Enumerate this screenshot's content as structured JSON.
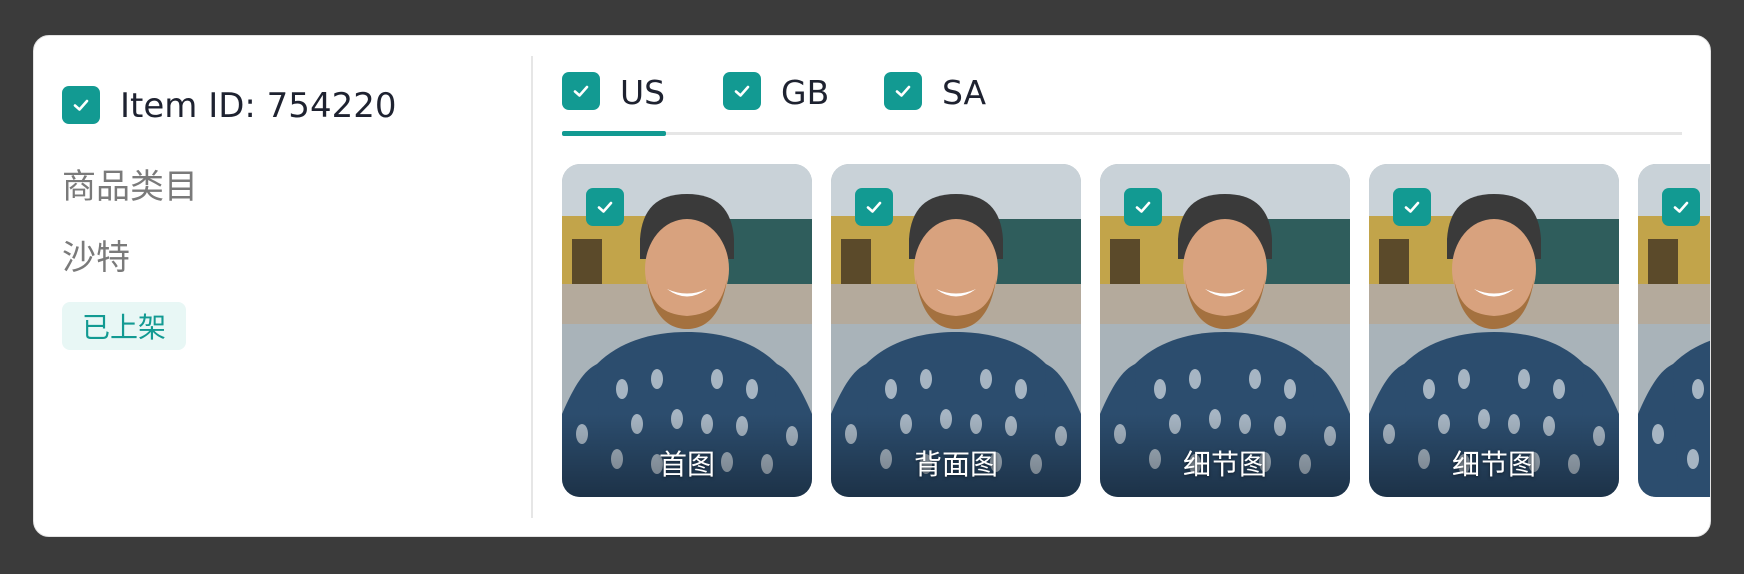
{
  "item": {
    "id_label": "Item ID: 754220",
    "checked": true,
    "category_label": "商品类目",
    "category_value": "沙特",
    "status": "已上架"
  },
  "tabs": [
    {
      "label": "US",
      "checked": true,
      "active": true
    },
    {
      "label": "GB",
      "checked": true,
      "active": false
    },
    {
      "label": "SA",
      "checked": true,
      "active": false
    }
  ],
  "gallery": {
    "images": [
      {
        "caption": "首图",
        "checked": true
      },
      {
        "caption": "背面图",
        "checked": true
      },
      {
        "caption": "细节图",
        "checked": true
      },
      {
        "caption": "细节图",
        "checked": true
      },
      {
        "caption": "",
        "checked": true
      }
    ]
  },
  "colors": {
    "accent": "#129a92",
    "badge_bg": "#e8f7f5",
    "background": "#3b3b3b"
  },
  "icons": {
    "checkbox": "check-icon"
  }
}
